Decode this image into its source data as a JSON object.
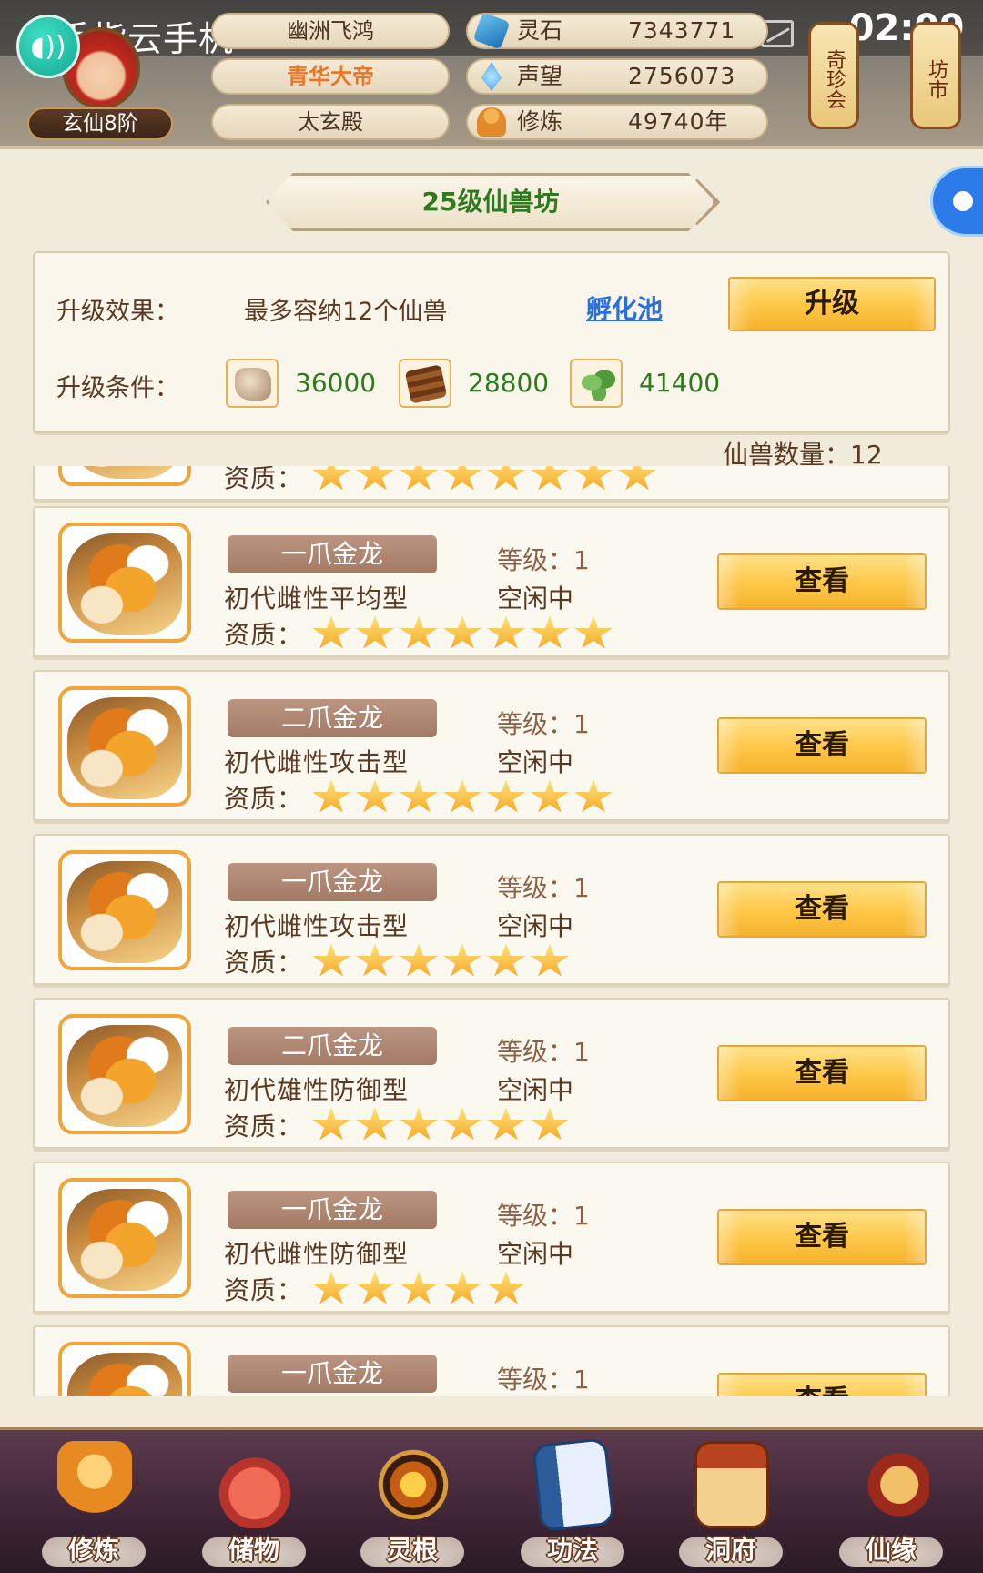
{
  "status_bar": {
    "app_title": "手指云手机",
    "time": "02:09"
  },
  "player": {
    "rank": "玄仙8阶",
    "names": [
      "幽洲飞鸿",
      "青华大帝",
      "太玄殿"
    ],
    "stats": [
      {
        "icon": "spirit-stone-icon",
        "label": "灵石",
        "value": "7343771"
      },
      {
        "icon": "reputation-icon",
        "label": "声望",
        "value": "2756073"
      },
      {
        "icon": "cultivation-icon",
        "label": "修炼",
        "value": "49740年"
      }
    ],
    "lanterns": [
      "奇珍会",
      "坊市"
    ]
  },
  "panel": {
    "title": "25级仙兽坊",
    "upgrade": {
      "effect_label": "升级效果：",
      "effect_text": "最多容纳12个仙兽",
      "hatch_link": "孵化池",
      "upgrade_button": "升级",
      "cond_label": "升级条件：",
      "materials": [
        {
          "icon": "ore-icon",
          "value": "36000"
        },
        {
          "icon": "wood-icon",
          "value": "28800"
        },
        {
          "icon": "herb-icon",
          "value": "41400"
        }
      ]
    },
    "count_text": "仙兽数量：12"
  },
  "beasts": [
    {
      "name": "",
      "desc": "",
      "level": "",
      "status": "",
      "quality_label": "资质：",
      "stars": 8,
      "view": ""
    },
    {
      "name": "一爪金龙",
      "desc": "初代雌性平均型",
      "level": "等级：1",
      "status": "空闲中",
      "quality_label": "资质：",
      "stars": 7,
      "view": "查看"
    },
    {
      "name": "二爪金龙",
      "desc": "初代雌性攻击型",
      "level": "等级：1",
      "status": "空闲中",
      "quality_label": "资质：",
      "stars": 7,
      "view": "查看"
    },
    {
      "name": "一爪金龙",
      "desc": "初代雌性攻击型",
      "level": "等级：1",
      "status": "空闲中",
      "quality_label": "资质：",
      "stars": 6,
      "view": "查看"
    },
    {
      "name": "二爪金龙",
      "desc": "初代雄性防御型",
      "level": "等级：1",
      "status": "空闲中",
      "quality_label": "资质：",
      "stars": 6,
      "view": "查看"
    },
    {
      "name": "一爪金龙",
      "desc": "初代雌性防御型",
      "level": "等级：1",
      "status": "空闲中",
      "quality_label": "资质：",
      "stars": 5,
      "view": "查看"
    },
    {
      "name": "一爪金龙",
      "desc": "",
      "level": "等级：1",
      "status": "",
      "quality_label": "",
      "stars": 0,
      "view": "查看"
    }
  ],
  "bottom_nav": [
    {
      "label": "修炼",
      "icon": "cultivate-icon"
    },
    {
      "label": "储物",
      "icon": "storage-bag-icon"
    },
    {
      "label": "灵根",
      "icon": "spirit-root-icon"
    },
    {
      "label": "功法",
      "icon": "technique-book-icon"
    },
    {
      "label": "洞府",
      "icon": "cave-dwelling-icon"
    },
    {
      "label": "仙缘",
      "icon": "fate-gourd-icon"
    }
  ]
}
